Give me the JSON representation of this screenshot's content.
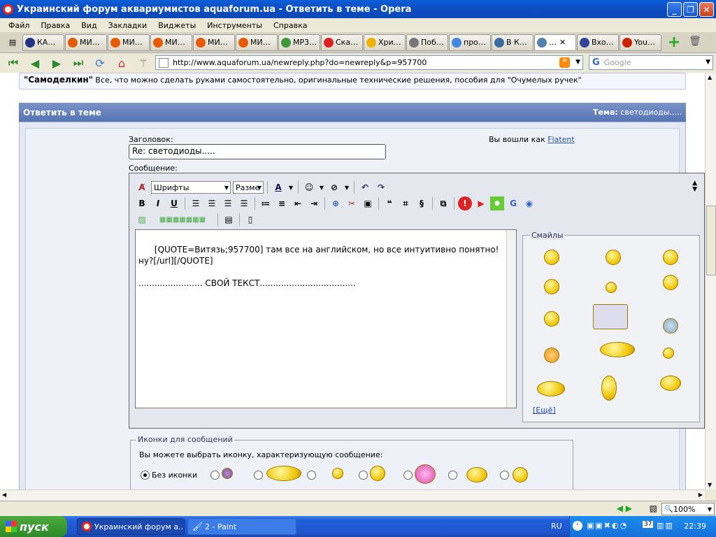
{
  "window": {
    "title": "Украинский форум аквариумистов aquaforum.ua - Ответить в теме - Opera"
  },
  "menu": [
    "Файл",
    "Правка",
    "Вид",
    "Закладки",
    "Виджеты",
    "Инструменты",
    "Справка"
  ],
  "tabs": [
    {
      "label": "КА…",
      "color": "#223388"
    },
    {
      "label": "МИ…",
      "color": "#e65a00"
    },
    {
      "label": "МИ…",
      "color": "#e65a00"
    },
    {
      "label": "МИ…",
      "color": "#e65a00"
    },
    {
      "label": "МИ…",
      "color": "#e65a00"
    },
    {
      "label": "МИ…",
      "color": "#e65a00"
    },
    {
      "label": "МР3…",
      "color": "#3a9a3a"
    },
    {
      "label": "Ска…",
      "color": "#dd2222"
    },
    {
      "label": "Хри…",
      "color": "#f0b000"
    },
    {
      "label": "Поб…",
      "color": "#777777"
    },
    {
      "label": "про…",
      "color": "#4488dd"
    },
    {
      "label": "В К…",
      "color": "#3a6aa0"
    },
    {
      "label": "…",
      "color": "#5580aa"
    },
    {
      "label": "Вхо…",
      "color": "#334499"
    },
    {
      "label": "You…",
      "color": "#cc2200"
    }
  ],
  "address": {
    "url": "http://www.aquaforum.ua/newreply.php?do=newreply&p=957700",
    "search_placeholder": "Google"
  },
  "page": {
    "top_note_bold": "\"Самоделкин\"",
    "top_note_text": " Все, что можно сделать руками самостоятельно, оригинальные технические решения, пособия для \"Очумелых ручек\"",
    "reply_header": "Ответить в теме",
    "topic_label": "Тема:",
    "topic_value": " светодиоды.....",
    "title_label": "Заголовок:",
    "title_value": "Re: светодиоды.....",
    "logged_in_text": "Вы вошли как ",
    "logged_in_user": "Flatent",
    "message_label": "Сообщение:"
  },
  "editor": {
    "font_select": "Шрифты",
    "size_select": "Разме",
    "message_text": "[QUOTE=Витязь;957700] там все на английском, но все интуитивно понятно! ну?[/url][/QUOTE]\n\n........................ СВОЙ ТЕКСТ....................................",
    "smilies_legend": "Смайлы",
    "more_link": "[Ещё]"
  },
  "icons_section": {
    "legend": "Иконки для сообщений",
    "description": "Вы можете выбрать иконку, характеризующую сообщение:",
    "no_icon_label": "Без иконки"
  },
  "statusbar": {
    "zoom": "100%"
  },
  "taskbar": {
    "start_label": "пуск",
    "items": [
      "Украинский форум а...",
      "2 - Paint"
    ],
    "lang": "RU",
    "tray_number": "37",
    "clock": "22:39"
  }
}
